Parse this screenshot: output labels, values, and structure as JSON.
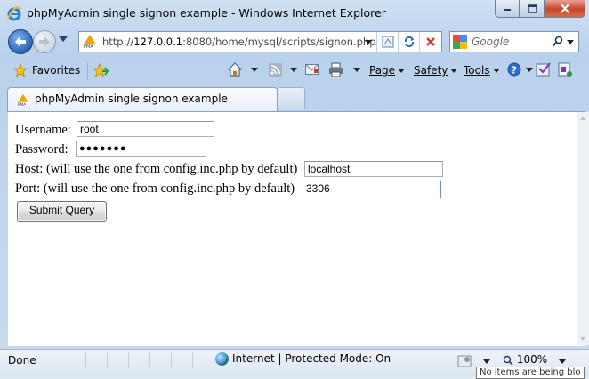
{
  "window": {
    "title": "phpMyAdmin single signon example - Windows Internet Explorer"
  },
  "address_bar": {
    "url_prefix": "http://",
    "url_host": "127.0.0.1",
    "url_rest": ":8080/home/mysql/scripts/signon.php"
  },
  "search": {
    "placeholder": "Google"
  },
  "command_bar": {
    "favorites_label": "Favorites",
    "page_label": "Page",
    "safety_label": "Safety",
    "tools_label": "Tools"
  },
  "tab": {
    "label": "phpMyAdmin single signon example"
  },
  "form": {
    "username_label": "Username:",
    "username_value": "root",
    "password_label": "Password:",
    "password_value": "●●●●●●●",
    "host_label": "Host: (will use the one from config.inc.php by default)",
    "host_value": "localhost",
    "port_label": "Port: (will use the one from config.inc.php by default)",
    "port_value": "3306",
    "submit_label": "Submit Query"
  },
  "status_bar": {
    "status": "Done",
    "zone": "Internet | Protected Mode: On",
    "zoom": "100%",
    "tooltip": "No items are being blo"
  },
  "colors": {
    "frame": "#c9dbef",
    "close_button": "#c7452c",
    "accent": "#2c62b5"
  }
}
